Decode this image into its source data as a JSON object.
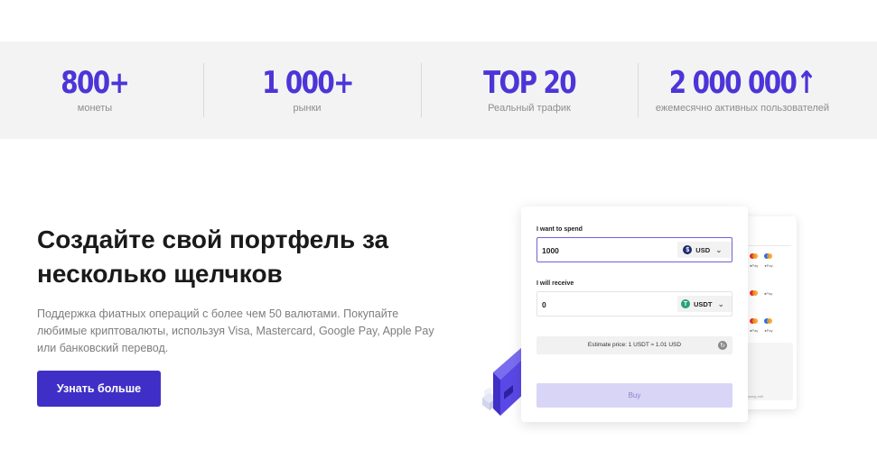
{
  "stats": [
    {
      "value": "800+",
      "label": "монеты"
    },
    {
      "value": "1 000+",
      "label": "рынки"
    },
    {
      "value": "TOP 20",
      "label": "Реальный трафик"
    },
    {
      "value": "2 000 000↑",
      "label": "ежемесячно активных пользователей"
    }
  ],
  "hero": {
    "title": "Создайте свой портфель за несколько щелчков",
    "description": "Поддержка фиатных операций с более чем 50 валютами. Покупайте любимые криптовалюты, используя Visa, Mastercard, Google Pay, Apple Pay или банковский перевод.",
    "cta_label": "Узнать больше"
  },
  "widget": {
    "spend_label": "I want to spend",
    "spend_value": "1000",
    "spend_currency": "USD",
    "spend_coin_symbol": "$",
    "receive_label": "I will receive",
    "receive_value": "0",
    "receive_currency": "USDT",
    "receive_coin_symbol": "T",
    "estimate": "Estimate price: 1 USDT ≈ 1.01 USD",
    "buy_label": "Buy",
    "back_card_caption": "ssing edit"
  },
  "colors": {
    "accent": "#4c35d8",
    "button": "#3f2fc7",
    "band_bg": "#f3f3f3",
    "buy_disabled": "#d9d5f6"
  },
  "icons": {
    "spend_coin": "usd-coin-icon",
    "receive_coin": "tether-coin-icon",
    "dropdown": "chevron-down-icon",
    "refresh": "refresh-icon",
    "wallet": "wallet-illustration"
  }
}
